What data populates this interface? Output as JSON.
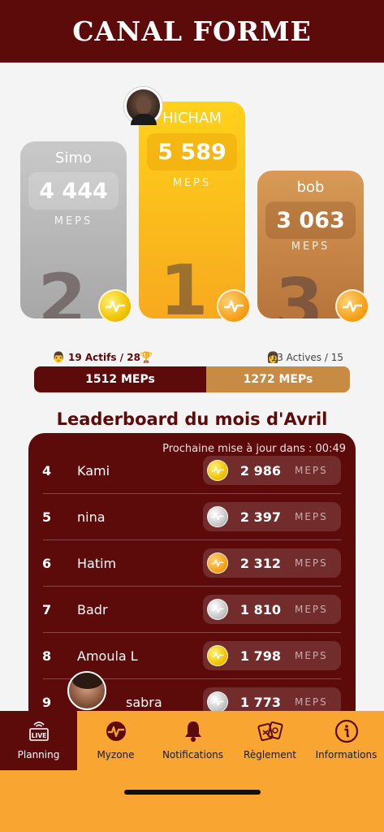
{
  "header": {
    "title": "CANAL FORME"
  },
  "podium": {
    "first": {
      "name": "HICHAM",
      "score": "5 589",
      "unit": "MEPS",
      "rank": "1"
    },
    "second": {
      "name": "Simo",
      "score": "4 444",
      "unit": "MEPS",
      "rank": "2"
    },
    "third": {
      "name": "bob",
      "score": "3 063",
      "unit": "MEPS",
      "rank": "3"
    }
  },
  "teams": {
    "left_label": "19 Actifs / 28",
    "right_label": "13 Actives / 15",
    "left_score": "1512 MEPs",
    "right_score": "1272 MEPs",
    "left_share": 0.545
  },
  "leaderboard": {
    "title": "Leaderboard du mois d'Avril",
    "update_text": "Prochaine mise à jour dans : 00:49",
    "rows": [
      {
        "rank": "4",
        "name": "Kami",
        "points": "2 986",
        "unit": "MEPS",
        "coin": "gold"
      },
      {
        "rank": "5",
        "name": "nina",
        "points": "2 397",
        "unit": "MEPS",
        "coin": "silver"
      },
      {
        "rank": "6",
        "name": "Hatim",
        "points": "2 312",
        "unit": "MEPS",
        "coin": "orange"
      },
      {
        "rank": "7",
        "name": "Badr",
        "points": "1 810",
        "unit": "MEPS",
        "coin": "silver"
      },
      {
        "rank": "8",
        "name": "Amoula L",
        "points": "1 798",
        "unit": "MEPS",
        "coin": "gold"
      },
      {
        "rank": "9",
        "name": "sabra",
        "points": "1 773",
        "unit": "MEPS",
        "coin": "silver"
      }
    ]
  },
  "tabs": [
    {
      "label": "Planning",
      "icon": "live-tv-icon",
      "active": true
    },
    {
      "label": "Myzone",
      "icon": "heartbeat-icon",
      "active": false
    },
    {
      "label": "Notifications",
      "icon": "bell-icon",
      "active": false
    },
    {
      "label": "Règlement",
      "icon": "tickets-icon",
      "active": false
    },
    {
      "label": "Informations",
      "icon": "info-icon",
      "active": false
    }
  ],
  "live_badge": "LIVE",
  "colors": {
    "brand": "#5c0a0a",
    "gold": "#f7a91e",
    "silver": "#a7a7a7",
    "bronze": "#b7743b",
    "tabbar": "#f8a532"
  }
}
